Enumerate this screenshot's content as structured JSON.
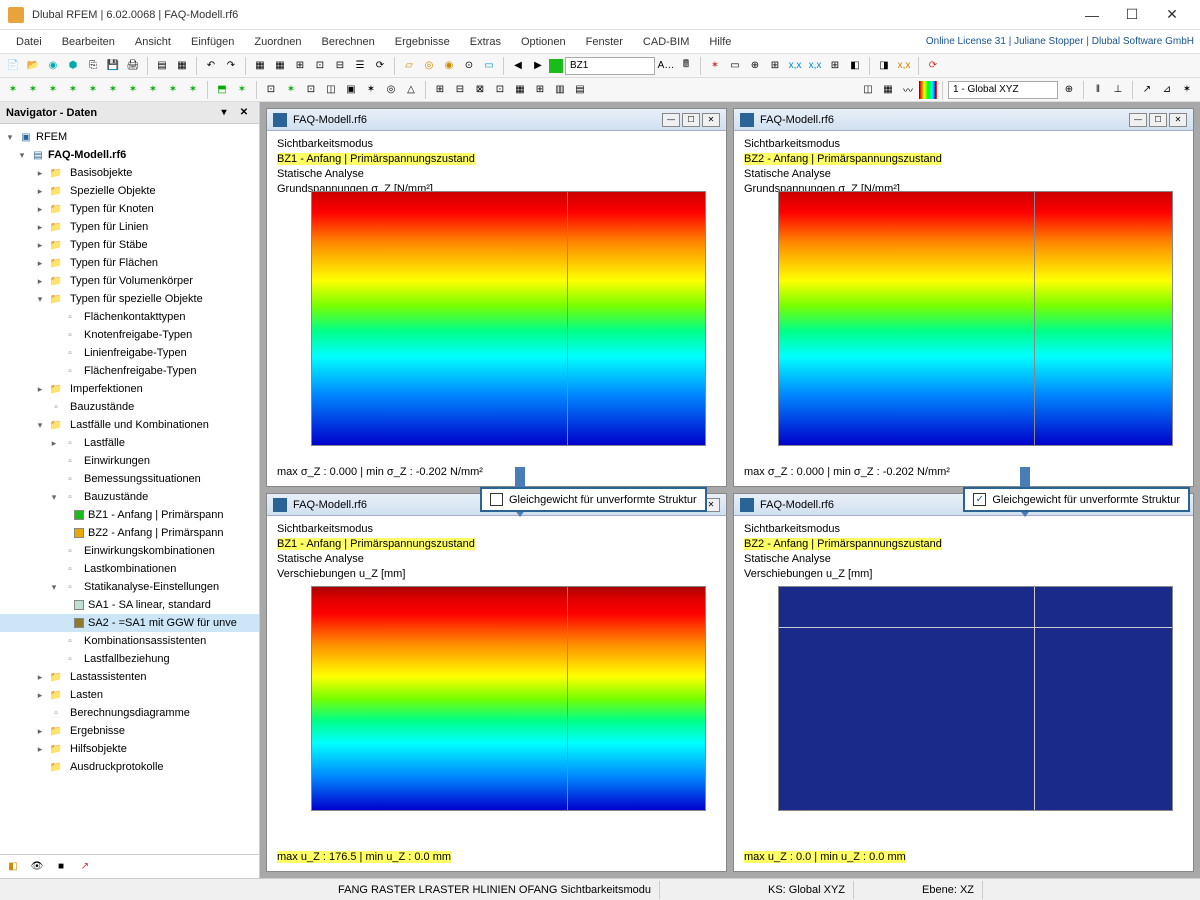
{
  "title": "Dlubal RFEM | 6.02.0068 | FAQ-Modell.rf6",
  "license": "Online License 31 | Juliane Stopper | Dlubal Software GmbH",
  "menu": [
    "Datei",
    "Bearbeiten",
    "Ansicht",
    "Einfügen",
    "Zuordnen",
    "Berechnen",
    "Ergebnisse",
    "Extras",
    "Optionen",
    "Fenster",
    "CAD-BIM",
    "Hilfe"
  ],
  "tb_bz": "BZ1",
  "tb_coord": "1 - Global XYZ",
  "nav": {
    "title": "Navigator - Daten",
    "root": "RFEM",
    "file": "FAQ-Modell.rf6",
    "items": [
      {
        "l": "Basisobjekte",
        "d": 2,
        "e": ">"
      },
      {
        "l": "Spezielle Objekte",
        "d": 2,
        "e": ">"
      },
      {
        "l": "Typen für Knoten",
        "d": 2,
        "e": ">"
      },
      {
        "l": "Typen für Linien",
        "d": 2,
        "e": ">"
      },
      {
        "l": "Typen für Stäbe",
        "d": 2,
        "e": ">"
      },
      {
        "l": "Typen für Flächen",
        "d": 2,
        "e": ">"
      },
      {
        "l": "Typen für Volumenkörper",
        "d": 2,
        "e": ">"
      },
      {
        "l": "Typen für spezielle Objekte",
        "d": 2,
        "e": "v",
        "open": true
      },
      {
        "l": "Flächenkontakttypen",
        "d": 3,
        "ic": "sub"
      },
      {
        "l": "Knotenfreigabe-Typen",
        "d": 3,
        "ic": "sub"
      },
      {
        "l": "Linienfreigabe-Typen",
        "d": 3,
        "ic": "sub"
      },
      {
        "l": "Flächenfreigabe-Typen",
        "d": 3,
        "ic": "sub"
      },
      {
        "l": "Imperfektionen",
        "d": 2,
        "e": ">"
      },
      {
        "l": "Bauzustände",
        "d": 2,
        "ic": "sub"
      },
      {
        "l": "Lastfälle und Kombinationen",
        "d": 2,
        "e": "v",
        "open": true
      },
      {
        "l": "Lastfälle",
        "d": 3,
        "e": ">",
        "ic": "sub"
      },
      {
        "l": "Einwirkungen",
        "d": 3,
        "ic": "sub"
      },
      {
        "l": "Bemessungssituationen",
        "d": 3,
        "ic": "sub"
      },
      {
        "l": "Bauzustände",
        "d": 3,
        "e": "v",
        "ic": "sub"
      },
      {
        "l": "BZ1 - Anfang | Primärspann",
        "d": 4,
        "sw": "#1abc1a"
      },
      {
        "l": "BZ2 - Anfang | Primärspann",
        "d": 4,
        "sw": "#e8a800"
      },
      {
        "l": "Einwirkungskombinationen",
        "d": 3,
        "ic": "sub"
      },
      {
        "l": "Lastkombinationen",
        "d": 3,
        "ic": "sub"
      },
      {
        "l": "Statikanalyse-Einstellungen",
        "d": 3,
        "e": "v",
        "ic": "sub"
      },
      {
        "l": "SA1 - SA linear, standard",
        "d": 4,
        "sw": "#bde0d0"
      },
      {
        "l": "SA2 - =SA1 mit GGW für unve",
        "d": 4,
        "sw": "#8a7a2a",
        "sel": true
      },
      {
        "l": "Kombinationsassistenten",
        "d": 3,
        "ic": "sub"
      },
      {
        "l": "Lastfallbeziehung",
        "d": 3,
        "ic": "sub"
      },
      {
        "l": "Lastassistenten",
        "d": 2,
        "e": ">"
      },
      {
        "l": "Lasten",
        "d": 2,
        "e": ">"
      },
      {
        "l": "Berechnungsdiagramme",
        "d": 2,
        "ic": "sub"
      },
      {
        "l": "Ergebnisse",
        "d": 2,
        "e": ">"
      },
      {
        "l": "Hilfsobjekte",
        "d": 2,
        "e": ">"
      },
      {
        "l": "Ausdruckprotokolle",
        "d": 2
      }
    ]
  },
  "views": {
    "file": "FAQ-Modell.rf6",
    "vis": "Sichtbarkeitsmodus",
    "bz1": "BZ1 - Anfang | Primärspannungszustand",
    "bz2": "BZ2 - Anfang | Primärspannungszustand",
    "ana": "Statische Analyse",
    "stress": "Grundspannungen σ_Z [N/mm²]",
    "disp": "Verschiebungen u_Z [mm]",
    "mm_stress": "max σ_Z : 0.000 | min σ_Z : -0.202 N/mm²",
    "mm_disp1": "max u_Z : 176.5 | min u_Z : 0.0 mm",
    "mm_disp2": "max u_Z : 0.0 | min u_Z : 0.0 mm",
    "check": "Gleichgewicht für unverformte Struktur"
  },
  "status": {
    "snap": "FANG RASTER LRASTER HLINIEN OFANG Sichtbarkeitsmodu",
    "ks": "KS: Global XYZ",
    "eb": "Ebene: XZ"
  }
}
